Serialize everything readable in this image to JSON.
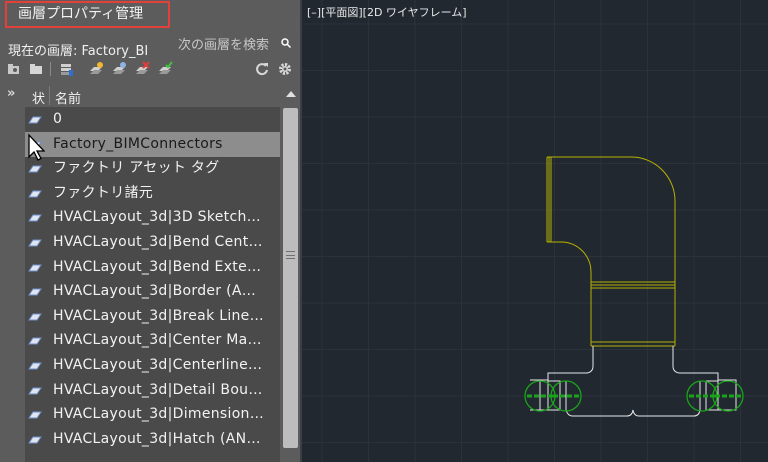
{
  "palette": {
    "title": "画層プロパティ管理",
    "current_layer_label": "現在の画層: Factory_BI",
    "search_placeholder": "次の画層を検索",
    "collapse_glyph": "»",
    "columns": {
      "status": "状",
      "name": "名前"
    },
    "layers": [
      {
        "name": "0",
        "selected": false
      },
      {
        "name": "Factory_BIMConnectors",
        "selected": true
      },
      {
        "name": "ファクトリ アセット タグ",
        "selected": false
      },
      {
        "name": "ファクトリ諸元",
        "selected": false
      },
      {
        "name": "HVACLayout_3d|3D  Sketch…",
        "selected": false
      },
      {
        "name": "HVACLayout_3d|Bend  Cent…",
        "selected": false
      },
      {
        "name": "HVACLayout_3d|Bend  Exte…",
        "selected": false
      },
      {
        "name": "HVACLayout_3d|Border  (A…",
        "selected": false
      },
      {
        "name": "HVACLayout_3d|Break  Line…",
        "selected": false
      },
      {
        "name": "HVACLayout_3d|Center  Ma…",
        "selected": false
      },
      {
        "name": "HVACLayout_3d|Centerline…",
        "selected": false
      },
      {
        "name": "HVACLayout_3d|Detail  Bou…",
        "selected": false
      },
      {
        "name": "HVACLayout_3d|Dimension…",
        "selected": false
      },
      {
        "name": "HVACLayout_3d|Hatch  (AN…",
        "selected": false
      }
    ],
    "toolbar_icons": [
      "new-property-filter-icon",
      "new-group-filter-icon",
      "layer-states-icon",
      "new-layer-icon",
      "new-layer-vp-frozen-icon",
      "delete-layer-icon",
      "set-current-icon",
      "refresh-icon",
      "settings-icon"
    ]
  },
  "viewport": {
    "label": "[–][平面図][2D ワイヤフレーム]",
    "colors": {
      "background": "#212830",
      "grid": "#2b323b",
      "drawing_yellow": "#b8b200",
      "drawing_white": "#e8e8e8",
      "connector_green": "#1aa31a"
    }
  }
}
